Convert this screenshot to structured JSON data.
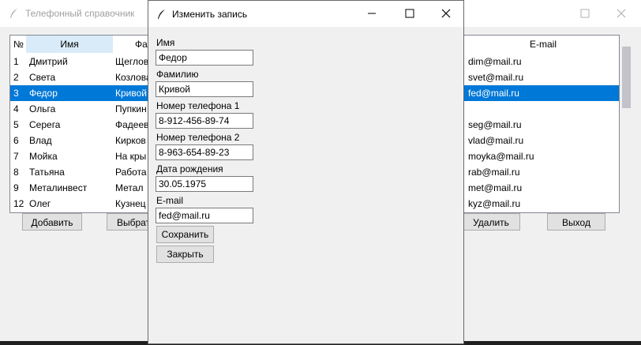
{
  "main_window": {
    "title": "Телефонный справочник",
    "controls": [
      "minimize-icon",
      "maximize-icon"
    ]
  },
  "table": {
    "headers": {
      "num": "№",
      "name": "Имя",
      "surname": "Фа",
      "email": "E-mail"
    },
    "rows": [
      {
        "num": "1",
        "name": "Дмитрий",
        "surname": "Щеглов",
        "email": "dim@mail.ru"
      },
      {
        "num": "2",
        "name": "Света",
        "surname": "Козлова",
        "email": "svet@mail.ru"
      },
      {
        "num": "3",
        "name": "Федор",
        "surname": "Кривой",
        "email": "fed@mail.ru",
        "selected": true
      },
      {
        "num": "4",
        "name": "Ольга",
        "surname": "Пупкин",
        "email": ""
      },
      {
        "num": "5",
        "name": "Серега",
        "surname": "Фадеев",
        "email": "seg@mail.ru"
      },
      {
        "num": "6",
        "name": "Влад",
        "surname": "Кирков",
        "email": "vlad@mail.ru"
      },
      {
        "num": "7",
        "name": "Мойка",
        "surname": "На кры",
        "email": "moyka@mail.ru"
      },
      {
        "num": "8",
        "name": "Татьяна",
        "surname": "Работа",
        "email": "rab@mail.ru"
      },
      {
        "num": "9",
        "name": "Металинвест",
        "surname": "Метал",
        "email": "met@mail.ru"
      },
      {
        "num": "12",
        "name": "Олег",
        "surname": "Кузнец",
        "email": "kyz@mail.ru"
      }
    ]
  },
  "buttons": {
    "add": "Добавить",
    "select": "Выбрат",
    "delete": "Удалить",
    "exit": "Выход"
  },
  "dialog": {
    "title": "Изменить запись",
    "fields": {
      "name_label": "Имя",
      "name_value": "Федор",
      "surname_label": "Фамилию",
      "surname_value": "Кривой",
      "phone1_label": "Номер телефона 1",
      "phone1_value": "8-912-456-89-74",
      "phone2_label": "Номер телефона 2",
      "phone2_value": "8-963-654-89-23",
      "birth_label": "Дата рождения",
      "birth_value": "30.05.1975",
      "email_label": "E-mail",
      "email_value": "fed@mail.ru"
    },
    "save": "Сохранить",
    "close": "Закрыть"
  },
  "colors": {
    "selection": "#0078d7",
    "header_selected": "#d9ebf9"
  }
}
